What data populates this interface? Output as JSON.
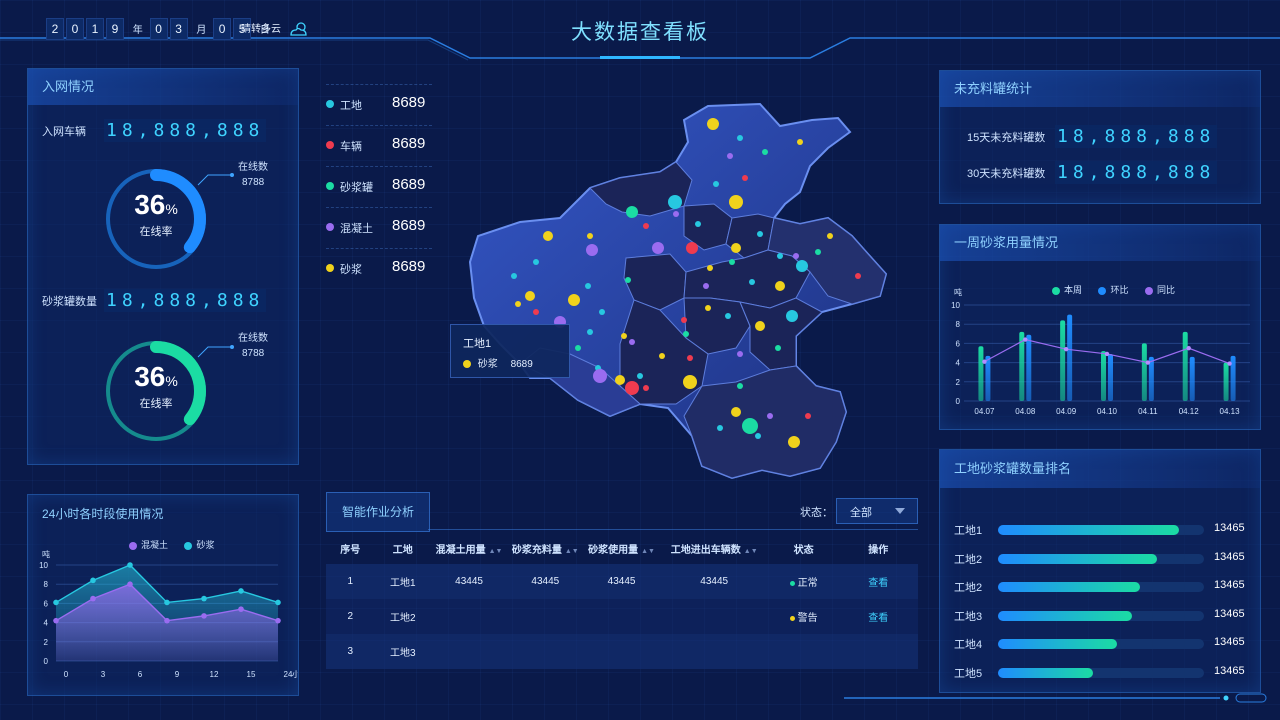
{
  "header": {
    "title": "大数据查看板",
    "date_digits": [
      "2",
      "0",
      "1",
      "9",
      "0",
      "3",
      "0",
      "5"
    ],
    "date_units": {
      "year": "年",
      "month": "月",
      "day": "日"
    },
    "weather": "晴转多云",
    "weather_icon": "cloud-sun-icon"
  },
  "network": {
    "title": "入网情况",
    "vehicles_label": "入网车辆",
    "vehicles_value": "18,888,888",
    "ring1": {
      "percent": 36,
      "percent_text": "36",
      "unit": "%",
      "caption": "在线率",
      "online_label": "在线数",
      "online_value": "8788",
      "color": "#1f8cff"
    },
    "tanks_label": "砂浆罐数量",
    "tanks_value": "18,888,888",
    "ring2": {
      "percent": 36,
      "percent_text": "36",
      "unit": "%",
      "caption": "在线率",
      "online_label": "在线数",
      "online_value": "8788",
      "color": "#1bdca3"
    }
  },
  "hourly": {
    "title": "24小时各时段使用情况",
    "legend": [
      {
        "name": "混凝土",
        "color": "#9a6cf0"
      },
      {
        "name": "砂浆",
        "color": "#27c8e0"
      }
    ],
    "y_unit": "吨",
    "x_unit": "小时"
  },
  "categories": [
    {
      "label": "工地",
      "value": "8689",
      "color": "#27c8e0"
    },
    {
      "label": "车辆",
      "value": "8689",
      "color": "#ef3b4f"
    },
    {
      "label": "砂浆罐",
      "value": "8689",
      "color": "#1bdca3"
    },
    {
      "label": "混凝土",
      "value": "8689",
      "color": "#9a6cf0"
    },
    {
      "label": "砂浆",
      "value": "8689",
      "color": "#f0d21c"
    }
  ],
  "map_tooltip": {
    "title": "工地1",
    "item_label": "砂浆",
    "item_value": "8689",
    "dot_color": "#f0d21c"
  },
  "analysis": {
    "title": "智能作业分析",
    "status_label": "状态：",
    "status_selected": "全部",
    "columns": [
      "序号",
      "工地",
      "混凝土用量",
      "砂浆充料量",
      "砂浆使用量",
      "工地进出车辆数",
      "状态",
      "操作"
    ],
    "rows": [
      {
        "no": "1",
        "site": "工地1",
        "concrete": "43445",
        "fill": "43445",
        "use": "43445",
        "vehicles": "43445",
        "status": "正常",
        "status_color": "#1bdca3",
        "action": "查看"
      },
      {
        "no": "2",
        "site": "工地2",
        "concrete": "",
        "fill": "",
        "use": "",
        "vehicles": "",
        "status": "警告",
        "status_color": "#f0d21c",
        "action": "查看"
      },
      {
        "no": "3",
        "site": "工地3",
        "concrete": "",
        "fill": "",
        "use": "",
        "vehicles": "",
        "status": "",
        "status_color": "",
        "action": ""
      }
    ]
  },
  "unfilled": {
    "title": "未充料罐统计",
    "row1_label": "15天未充料罐数",
    "row1_value": "18,888,888",
    "row2_label": "30天未充料罐数",
    "row2_value": "18,888,888"
  },
  "weekly": {
    "title": "一周砂浆用量情况",
    "legend": [
      {
        "name": "本周",
        "color": "#1bdca3"
      },
      {
        "name": "环比",
        "color": "#1f8cff"
      },
      {
        "name": "同比",
        "color": "#9a6cf0"
      }
    ],
    "y_unit": "吨"
  },
  "ranking": {
    "title": "工地砂浆罐数量排名",
    "items": [
      {
        "label": "工地1",
        "value": "13465",
        "ratio": 0.88
      },
      {
        "label": "工地2",
        "value": "13465",
        "ratio": 0.77
      },
      {
        "label": "工地2",
        "value": "13465",
        "ratio": 0.69
      },
      {
        "label": "工地3",
        "value": "13465",
        "ratio": 0.65
      },
      {
        "label": "工地4",
        "value": "13465",
        "ratio": 0.58
      },
      {
        "label": "工地5",
        "value": "13465",
        "ratio": 0.46
      }
    ]
  },
  "chart_data": [
    {
      "type": "area",
      "title": "24小时各时段使用情况",
      "ylabel": "吨",
      "xlabel": "小时",
      "x": [
        "0",
        "3",
        "6",
        "9",
        "12",
        "15",
        "24"
      ],
      "ylim": [
        0,
        10
      ],
      "yticks": [
        0,
        2,
        4,
        6,
        8,
        10
      ],
      "series": [
        {
          "name": "混凝土",
          "values": [
            4.2,
            6.5,
            8.0,
            4.2,
            4.7,
            5.4,
            4.2
          ]
        },
        {
          "name": "砂浆",
          "values": [
            6.1,
            8.4,
            10.0,
            6.1,
            6.5,
            7.3,
            6.1
          ]
        }
      ],
      "legend": "top",
      "grid": true
    },
    {
      "type": "bar",
      "title": "一周砂浆用量情况",
      "ylabel": "吨",
      "categories": [
        "04.07",
        "04.08",
        "04.09",
        "04.10",
        "04.11",
        "04.12",
        "04.13"
      ],
      "ylim": [
        0,
        10
      ],
      "yticks": [
        0,
        2,
        4,
        6,
        8,
        10
      ],
      "series": [
        {
          "name": "本周",
          "type": "bar",
          "values": [
            5.7,
            7.2,
            8.4,
            5.2,
            6.0,
            7.2,
            4.0
          ]
        },
        {
          "name": "环比",
          "type": "bar",
          "values": [
            4.7,
            6.9,
            9.0,
            4.9,
            4.6,
            4.6,
            4.7
          ]
        },
        {
          "name": "同比",
          "type": "line",
          "values": [
            4.1,
            6.4,
            5.4,
            4.9,
            4.0,
            5.5,
            3.9
          ]
        }
      ],
      "legend": "top",
      "grid": true
    }
  ]
}
